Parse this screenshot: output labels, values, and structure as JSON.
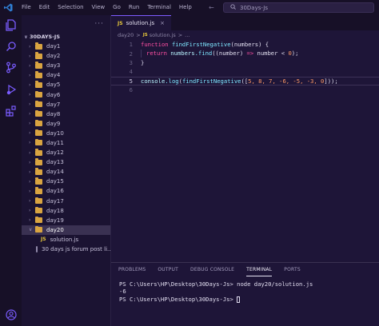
{
  "titlebar": {
    "menu": [
      "File",
      "Edit",
      "Selection",
      "View",
      "Go",
      "Run",
      "Terminal",
      "Help"
    ],
    "search_text": "30Days-Js",
    "accent": "#2f7fd6"
  },
  "sidebar": {
    "more_label": "···",
    "root_label": "30DAYS-JS",
    "folders": [
      "day1",
      "day2",
      "day3",
      "day4",
      "day5",
      "day6",
      "day7",
      "day8",
      "day9",
      "day10",
      "day11",
      "day12",
      "day13",
      "day14",
      "day15",
      "day16",
      "day17",
      "day18",
      "day19"
    ],
    "open_folder": "day20",
    "open_files": [
      {
        "name": "solution.js",
        "icon": "js-file-icon"
      },
      {
        "name": "30 days js forum post li...",
        "icon": "document-icon"
      }
    ],
    "folder_color": "#d9a441"
  },
  "editor": {
    "tab": {
      "badge": "JS",
      "label": "solution.js",
      "close": "×"
    },
    "breadcrumb": {
      "folder": "day20",
      "sep": ">",
      "badge": "JS",
      "file": "solution.js",
      "sep2": ">",
      "dots": "..."
    },
    "line_numbers": [
      "1",
      "2",
      "3",
      "4",
      "5",
      "6"
    ],
    "lines": [
      {
        "kw": "function",
        "fn": " findFirstNegative",
        "rest": "(numbers) {"
      },
      {
        "kw": "return",
        "obj": " numbers",
        "mth": ".find",
        "rest": "((number) ",
        "op": "=>",
        "tail": " number < ",
        "num": "0",
        "end": ");"
      },
      {
        "text": "}"
      },
      {
        "text": ""
      },
      {
        "obj": "console",
        "mth": ".log",
        "mid": "(",
        "fn": "findFirstNegative",
        "rest": "([",
        "nums": "5, 8, 7, -6, -5, -3, 0",
        "end": "]));"
      },
      {
        "text": ""
      }
    ],
    "current_line": "5"
  },
  "panel": {
    "tabs": [
      "PROBLEMS",
      "OUTPUT",
      "DEBUG CONSOLE",
      "TERMINAL",
      "PORTS"
    ],
    "active_tab": "TERMINAL",
    "terminal": [
      "PS C:\\Users\\HP\\Desktop\\30Days-Js> node day20/solution.js",
      "-6",
      "PS C:\\Users\\HP\\Desktop\\30Days-Js> "
    ]
  }
}
